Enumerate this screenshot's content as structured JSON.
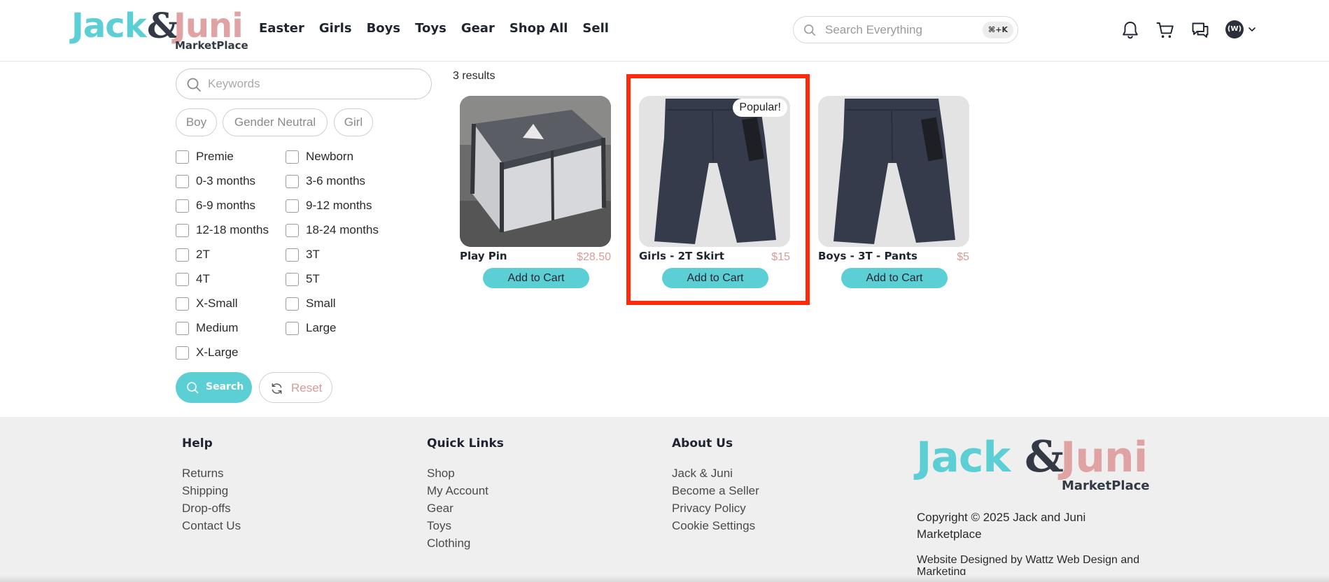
{
  "header": {
    "logo": {
      "jack": "Jack",
      "amp": "&",
      "juni": "Juni",
      "marketplace": "MarketPlace"
    },
    "nav": [
      "Easter",
      "Girls",
      "Boys",
      "Toys",
      "Gear",
      "Shop All",
      "Sell"
    ],
    "search": {
      "placeholder": "Search Everything",
      "shortcut": "⌘+K"
    },
    "icons": [
      "bell-icon",
      "cart-icon",
      "messages-icon"
    ],
    "avatar_initials": "(W)"
  },
  "filters": {
    "keywords_placeholder": "Keywords",
    "gender_chips": [
      "Boy",
      "Gender Neutral",
      "Girl"
    ],
    "sizes_left": [
      "Premie",
      "0-3 months",
      "6-9 months",
      "12-18 months",
      "2T",
      "4T",
      "X-Small",
      "Medium",
      "X-Large"
    ],
    "sizes_right": [
      "Newborn",
      "3-6 months",
      "9-12 months",
      "18-24 months",
      "3T",
      "5T",
      "Small",
      "Large"
    ],
    "search_label": "Search",
    "reset_label": "Reset"
  },
  "results": {
    "count_text": "3 results",
    "items": [
      {
        "name": "Play Pin",
        "price": "$28.50",
        "add_label": "Add to Cart",
        "badge": ""
      },
      {
        "name": "Girls - 2T Skirt",
        "price": "$15",
        "add_label": "Add to Cart",
        "badge": "Popular!"
      },
      {
        "name": "Boys - 3T - Pants",
        "price": "$5",
        "add_label": "Add to Cart",
        "badge": ""
      }
    ]
  },
  "footer": {
    "help": {
      "title": "Help",
      "links": [
        "Returns",
        "Shipping",
        "Drop-offs",
        "Contact Us"
      ]
    },
    "quick_links": {
      "title": "Quick Links",
      "links": [
        "Shop",
        "My Account",
        "Gear",
        "Toys",
        "Clothing"
      ]
    },
    "about": {
      "title": "About Us",
      "links": [
        "Jack & Juni",
        "Become a Seller",
        "Privacy Policy",
        "Cookie Settings"
      ]
    },
    "copyright": "Copyright © 2025 Jack and Juni Marketplace",
    "designed_by": "Website Designed by Wattz Web Design and Marketing"
  },
  "colors": {
    "accent": "#5ccfd4",
    "pink": "#e0a3a3",
    "highlight": "#ff2a0c",
    "dark": "#333a45"
  }
}
